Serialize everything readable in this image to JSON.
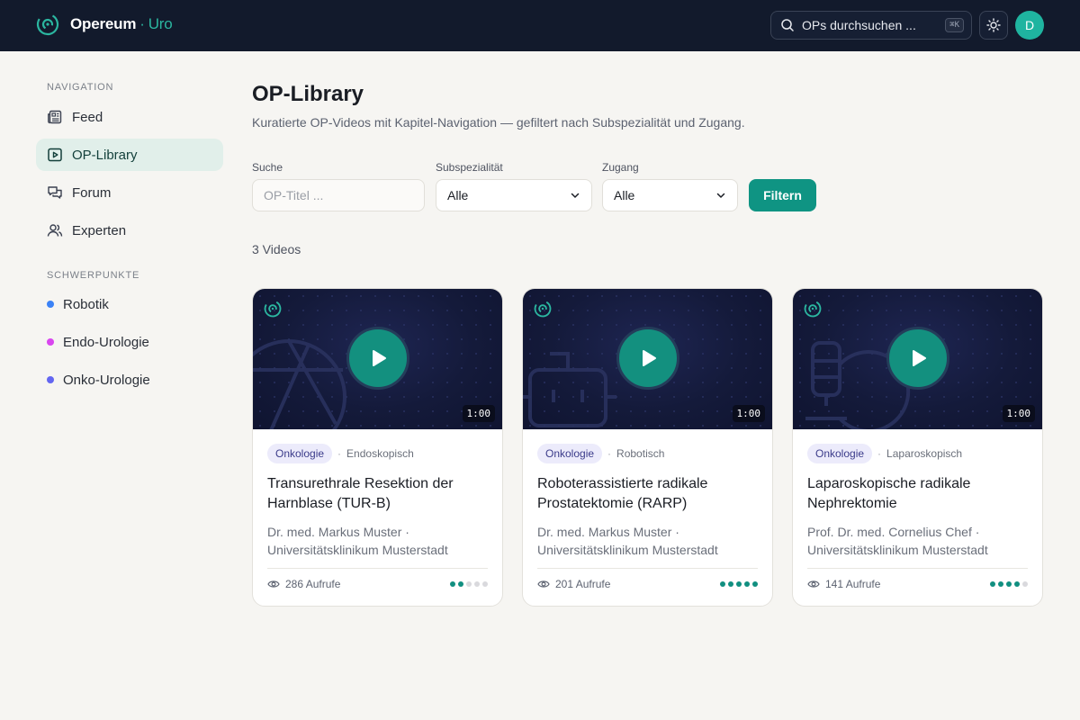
{
  "app": {
    "brand": "Opereum",
    "brand_sep": "·",
    "brand_sub": "Uro"
  },
  "header": {
    "search_placeholder": "OPs durchsuchen ...",
    "shortcut": "⌘K",
    "avatar_initial": "D"
  },
  "sidebar": {
    "nav_heading": "NAVIGATION",
    "nav_items": [
      {
        "label": "Feed",
        "icon": "newspaper-icon",
        "active": false
      },
      {
        "label": "OP-Library",
        "icon": "video-icon",
        "active": true
      },
      {
        "label": "Forum",
        "icon": "chat-icon",
        "active": false
      },
      {
        "label": "Experten",
        "icon": "users-icon",
        "active": false
      }
    ],
    "focus_heading": "SCHWERPUNKTE",
    "focus_items": [
      {
        "label": "Robotik",
        "color": "#3b82f6"
      },
      {
        "label": "Endo-Urologie",
        "color": "#d946ef"
      },
      {
        "label": "Onko-Urologie",
        "color": "#6366f1"
      }
    ]
  },
  "main": {
    "title": "OP-Library",
    "subtitle": "Kuratierte OP-Videos mit Kapitel-Navigation — gefiltert nach Subspezialität und Zugang.",
    "filters": {
      "search_label": "Suche",
      "search_placeholder": "OP-Titel ...",
      "subspecialty_label": "Subspezialität",
      "subspecialty_value": "Alle",
      "access_label": "Zugang",
      "access_value": "Alle",
      "button_label": "Filtern"
    },
    "count_text": "3 Videos",
    "cards": [
      {
        "duration": "1:00",
        "tag": "Onkologie",
        "access": "Endoskopisch",
        "title": "Transurethrale Resektion der Harnblase (TUR-B)",
        "author": "Dr. med. Markus Muster · Universitätsklinikum Musterstadt",
        "views": "286 Aufrufe",
        "rating": 2,
        "rating_max": 5
      },
      {
        "duration": "1:00",
        "tag": "Onkologie",
        "access": "Robotisch",
        "title": "Roboterassistierte radikale Prostatektomie (RARP)",
        "author": "Dr. med. Markus Muster · Universitätsklinikum Musterstadt",
        "views": "201 Aufrufe",
        "rating": 5,
        "rating_max": 5
      },
      {
        "duration": "1:00",
        "tag": "Onkologie",
        "access": "Laparoskopisch",
        "title": "Laparoskopische radikale Nephrektomie",
        "author": "Prof. Dr. med. Cornelius Chef · Universitätsklinikum Musterstadt",
        "views": "141 Aufrufe",
        "rating": 4,
        "rating_max": 5
      }
    ]
  },
  "colors": {
    "accent": "#0f9483",
    "topbar": "#121a2c",
    "background": "#f6f5f2"
  }
}
